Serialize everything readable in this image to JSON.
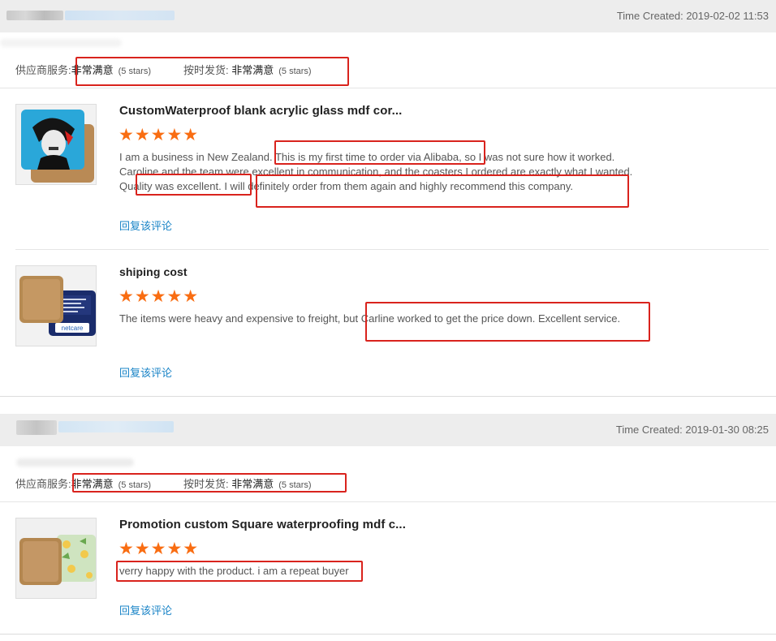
{
  "orders": [
    {
      "time_created": "Time Created: 2019-02-02 11:53",
      "ratings": {
        "supplier_label": "供应商服务:",
        "supplier_value": "非常满意",
        "supplier_stars": "(5 stars)",
        "shipping_label": "按时发货:",
        "shipping_value": "非常满意",
        "shipping_stars": "(5 stars)"
      },
      "items": [
        {
          "title": "CustomWaterproof blank acrylic glass mdf cor...",
          "stars": "★★★★★",
          "review": "I am a business in New Zealand. This is my first time to order via Alibaba, so I was not sure how it worked. Caroline and the team were excellent in communication, and the coasters I ordered are exactly what I wanted. Quality was excellent. I will definitely order from them again and highly recommend this company.",
          "reply": "回复该评论"
        },
        {
          "title": "shiping cost",
          "stars": "★★★★★",
          "review": "The items were heavy and expensive to freight, but Carline worked to get the price down.  Excellent service.",
          "reply": "回复该评论",
          "image_text": "netcare"
        }
      ]
    },
    {
      "time_created": "Time Created: 2019-01-30 08:25",
      "ratings": {
        "supplier_label": "供应商服务:",
        "supplier_value": "非常满意",
        "supplier_stars": "(5 stars)",
        "shipping_label": "按时发货:",
        "shipping_value": "非常满意",
        "shipping_stars": "(5 stars)"
      },
      "items": [
        {
          "title": "Promotion custom Square waterproofing mdf c...",
          "stars": "★★★★★",
          "review": "verry happy with the product. i am a repeat buyer",
          "reply": "回复该评论"
        }
      ]
    }
  ],
  "colors": {
    "star": "#f96d12",
    "link": "#1a84c7",
    "highlight_box": "#d9231d",
    "header_bg": "#ededed"
  }
}
